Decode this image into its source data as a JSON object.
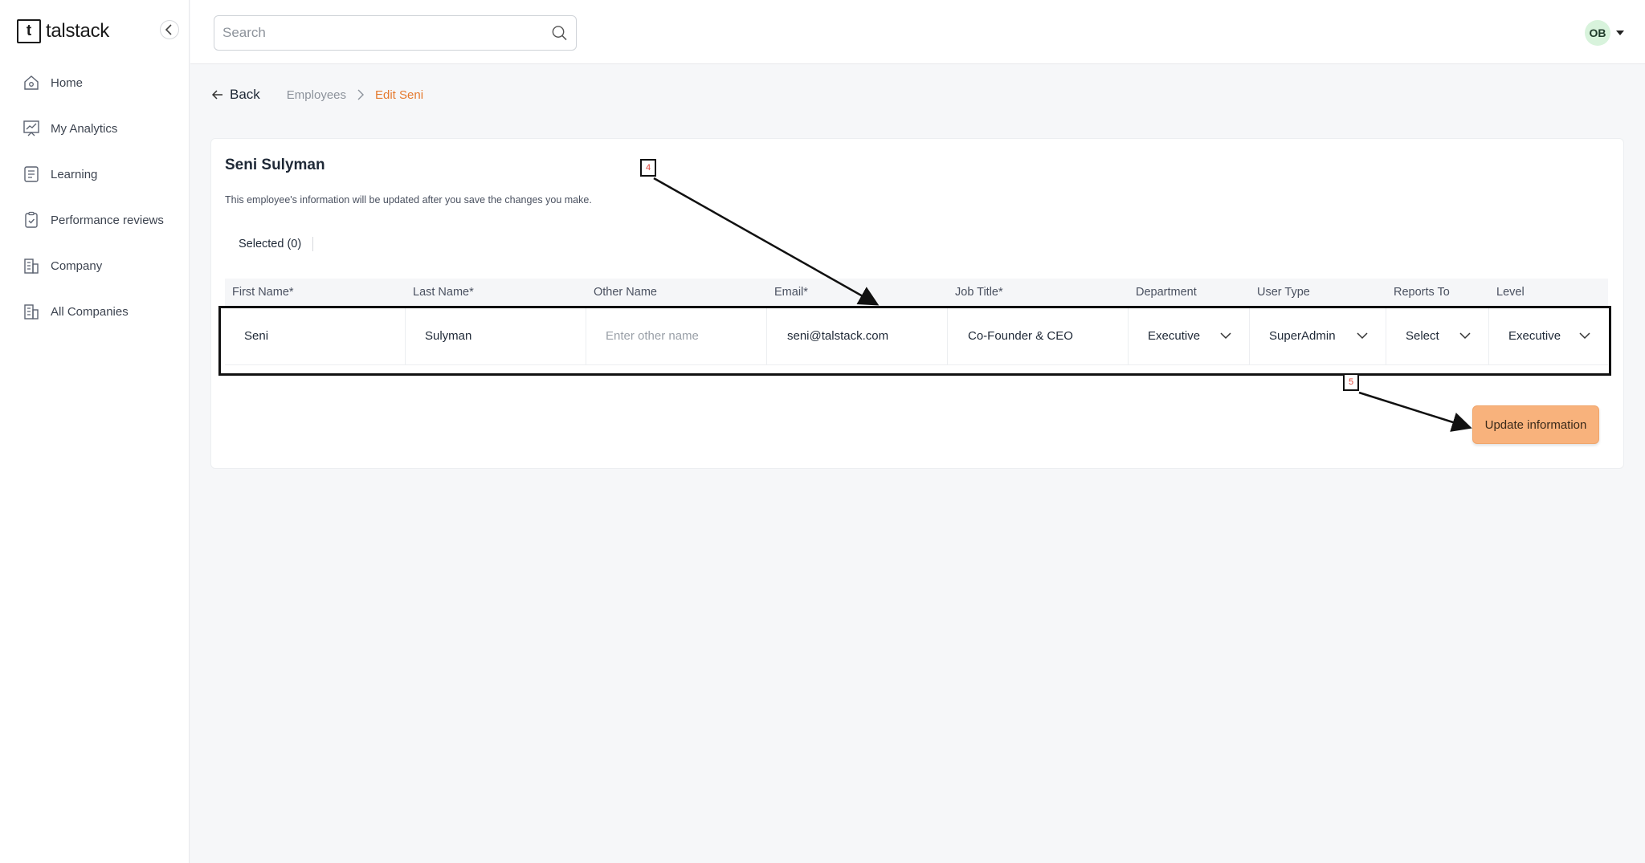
{
  "app": {
    "logo_mark": "t",
    "logo_text": "talstack"
  },
  "sidebar": {
    "items": [
      {
        "label": "Home",
        "icon": "home-icon"
      },
      {
        "label": "My Analytics",
        "icon": "analytics-icon"
      },
      {
        "label": "Learning",
        "icon": "book-icon"
      },
      {
        "label": "Performance reviews",
        "icon": "clipboard-check-icon"
      },
      {
        "label": "Company",
        "icon": "building-icon"
      },
      {
        "label": "All Companies",
        "icon": "buildings-icon"
      }
    ]
  },
  "header": {
    "search_placeholder": "Search",
    "avatar_initials": "OB"
  },
  "breadcrumb": {
    "back_label": "Back",
    "parent": "Employees",
    "current": "Edit Seni"
  },
  "card": {
    "title": "Seni Sulyman",
    "description": "This employee's information will be updated after you save the changes you make.",
    "selected_label": "Selected (0)",
    "columns": [
      "First Name*",
      "Last Name*",
      "Other Name",
      "Email*",
      "Job Title*",
      "Department",
      "User Type",
      "Reports To",
      "Level"
    ],
    "row": {
      "first_name": "Seni",
      "last_name": "Sulyman",
      "other_name": "",
      "other_name_placeholder": "Enter other name",
      "email": "seni@talstack.com",
      "job_title": "Co-Founder & CEO",
      "department": "Executive",
      "user_type": "SuperAdmin",
      "reports_to": "Select",
      "level": "Executive"
    },
    "update_button": "Update information"
  },
  "annotations": [
    {
      "label": "4"
    },
    {
      "label": "5"
    }
  ],
  "colors": {
    "accent": "#e57a2e",
    "button_bg": "#f8b27c",
    "avatar_bg": "#d8f3dc"
  }
}
